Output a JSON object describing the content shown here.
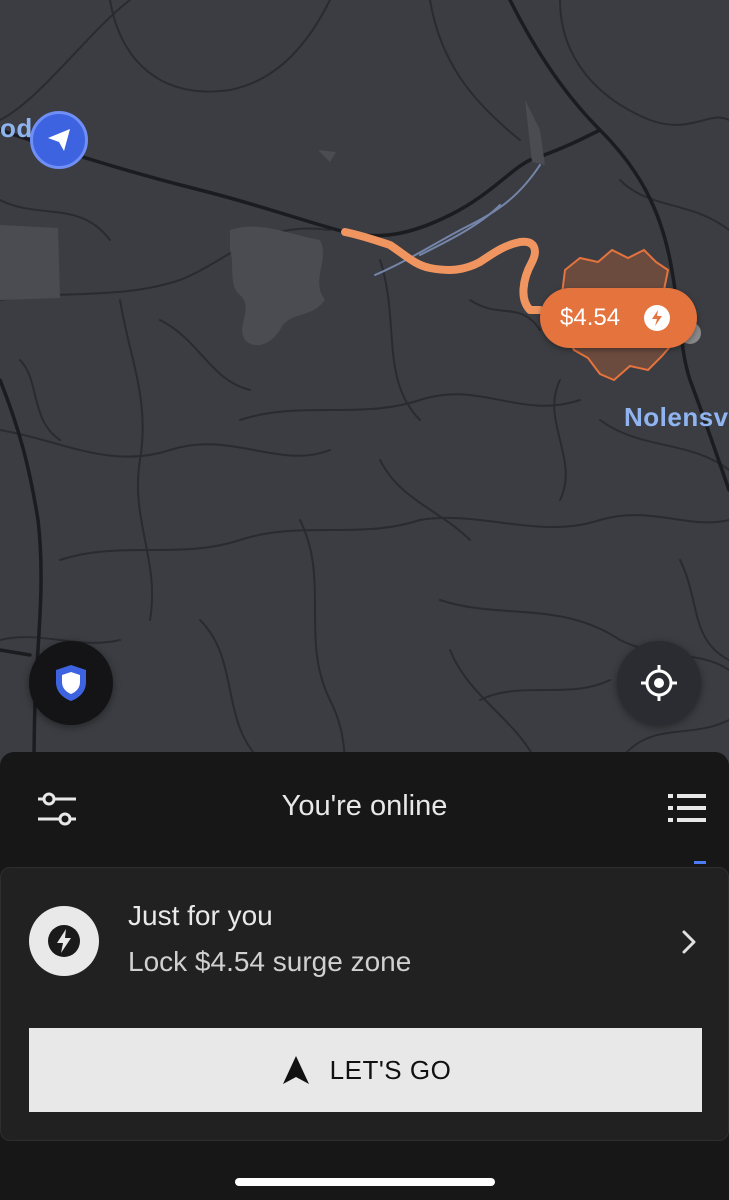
{
  "map": {
    "place_labels": [
      "od",
      "Nolensv"
    ],
    "surge_price": "$4.54",
    "route_color": "#f0955f",
    "surge_color": "#e4733d",
    "nav_marker_color": "#3d63e0"
  },
  "icons": {
    "nav_marker": "navigation-arrow-icon",
    "surge_bolt": "lightning-bolt-icon",
    "safety": "shield-icon",
    "locate": "crosshair-icon",
    "preferences": "sliders-icon",
    "list": "list-icon",
    "chevron": "chevron-right-icon",
    "go": "navigation-arrow-icon"
  },
  "status": {
    "title": "You're online"
  },
  "promo": {
    "title": "Just for you",
    "subtitle": "Lock $4.54 surge zone"
  },
  "action": {
    "go_label": "LET'S GO"
  }
}
